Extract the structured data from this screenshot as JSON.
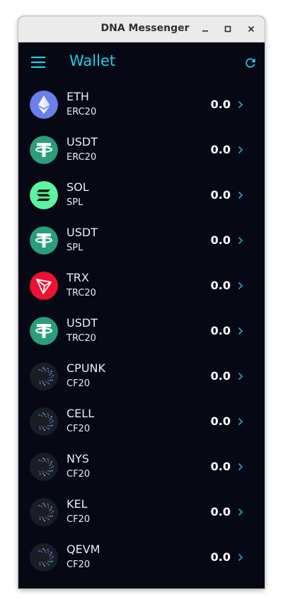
{
  "window": {
    "title": "DNA Messenger"
  },
  "appbar": {
    "title": "Wallet",
    "menu_icon": "hamburger-menu-icon",
    "refresh_icon": "refresh-icon"
  },
  "colors": {
    "accent": "#1fd1e8",
    "background": "#060814",
    "eth": "#6b7fe8",
    "usdt": "#2a9d7c",
    "sol": "#5cf59f",
    "trx": "#ee1130",
    "cellframe": "#1b1d24"
  },
  "tokens": [
    {
      "symbol": "ETH",
      "network": "ERC20",
      "amount": "0.0",
      "icon": "eth-icon"
    },
    {
      "symbol": "USDT",
      "network": "ERC20",
      "amount": "0.0",
      "icon": "usdt-icon"
    },
    {
      "symbol": "SOL",
      "network": "SPL",
      "amount": "0.0",
      "icon": "sol-icon"
    },
    {
      "symbol": "USDT",
      "network": "SPL",
      "amount": "0.0",
      "icon": "usdt-icon"
    },
    {
      "symbol": "TRX",
      "network": "TRC20",
      "amount": "0.0",
      "icon": "trx-icon"
    },
    {
      "symbol": "USDT",
      "network": "TRC20",
      "amount": "0.0",
      "icon": "usdt-icon"
    },
    {
      "symbol": "CPUNK",
      "network": "CF20",
      "amount": "0.0",
      "icon": "cellframe-icon"
    },
    {
      "symbol": "CELL",
      "network": "CF20",
      "amount": "0.0",
      "icon": "cellframe-icon"
    },
    {
      "symbol": "NYS",
      "network": "CF20",
      "amount": "0.0",
      "icon": "cellframe-icon"
    },
    {
      "symbol": "KEL",
      "network": "CF20",
      "amount": "0.0",
      "icon": "cellframe-icon"
    },
    {
      "symbol": "QEVM",
      "network": "CF20",
      "amount": "0.0",
      "icon": "cellframe-icon"
    }
  ]
}
